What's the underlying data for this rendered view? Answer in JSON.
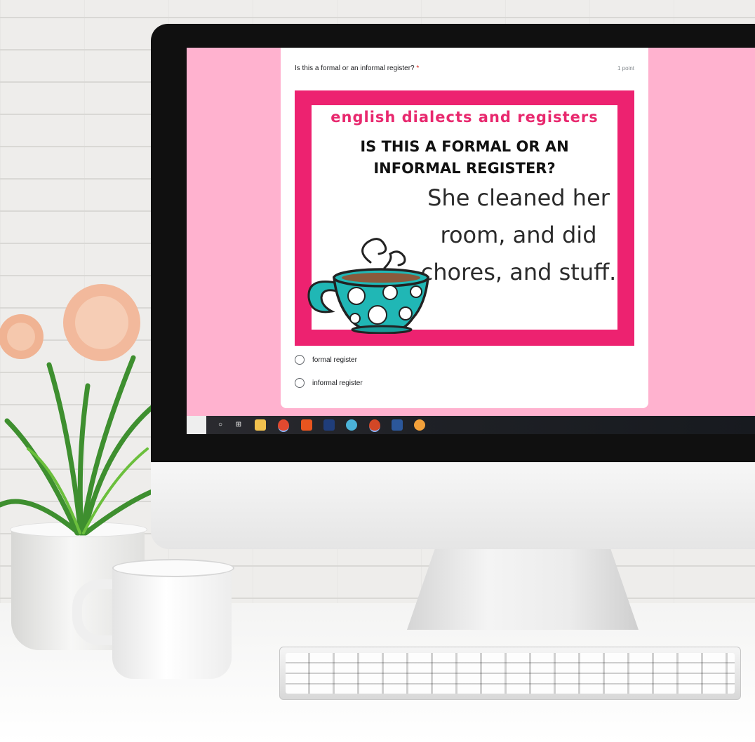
{
  "form": {
    "question_title": "Is this a formal or an informal register?",
    "required_marker": "*",
    "points": "1 point",
    "options": [
      {
        "label": "formal register"
      },
      {
        "label": "informal register"
      }
    ]
  },
  "slide": {
    "header": "english dialects and registers",
    "question": "IS THIS A FORMAL OR AN INFORMAL REGISTER?",
    "sentence": "She cleaned her room, and did chores, and stuff.",
    "colors": {
      "frame": "#ed2270",
      "accent_text": "#e8286e",
      "cup": "#20b7b5"
    },
    "image_icon": "teacup-icon"
  },
  "taskbar": {
    "icons": [
      "search-icon",
      "task-view-icon",
      "file-explorer-icon",
      "chrome-icon",
      "office-icon",
      "acrobat-icon",
      "app-icon",
      "powerpoint-icon",
      "word-icon",
      "app-icon"
    ]
  },
  "colors": {
    "screen_background": "#ffb2cf",
    "card_background": "#ffffff"
  }
}
